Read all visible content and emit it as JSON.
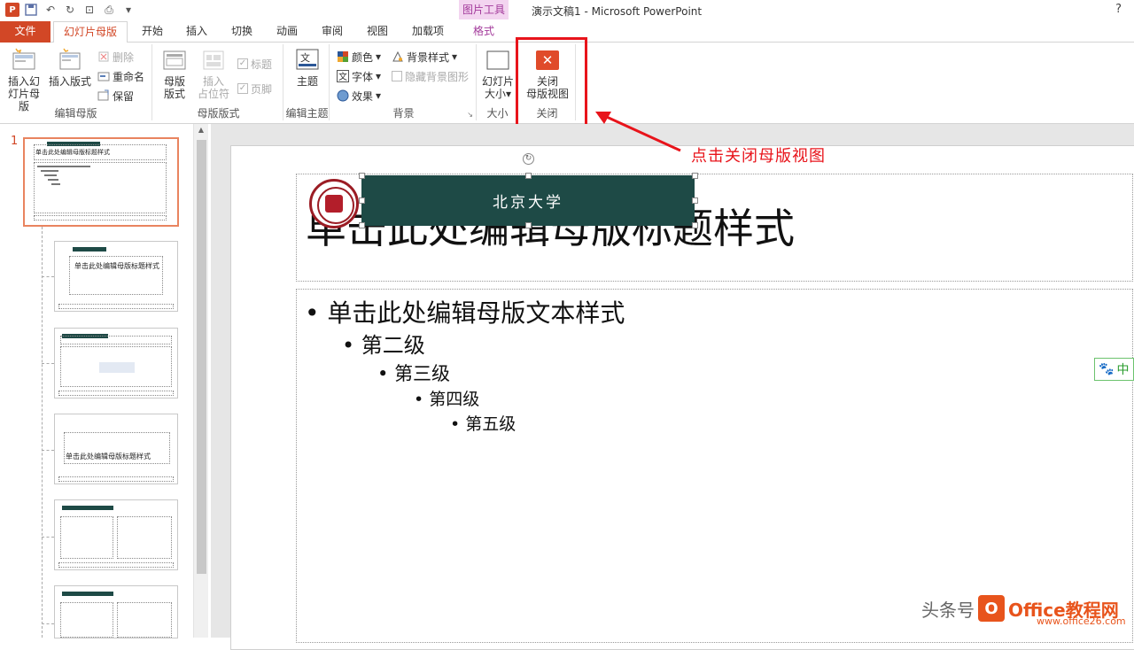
{
  "window": {
    "title": "演示文稿1 - Microsoft PowerPoint",
    "contextual_group": "图片工具",
    "help": "?"
  },
  "tabs": {
    "file": "文件",
    "slide_master": "幻灯片母版",
    "home": "开始",
    "insert": "插入",
    "transitions": "切换",
    "animations": "动画",
    "review": "审阅",
    "view": "视图",
    "addins": "加载项",
    "format": "格式"
  },
  "ribbon": {
    "edit_master": {
      "label": "编辑母版",
      "insert_master": "插入幻灯片母版",
      "insert_master_l1": "插入幻",
      "insert_master_l2": "灯片母版",
      "insert_layout": "插入版式",
      "delete": "删除",
      "rename": "重命名",
      "preserve": "保留"
    },
    "master_layout": {
      "label": "母版版式",
      "master_layout_l1": "母版",
      "master_layout_l2": "版式",
      "insert_placeholder_l1": "插入",
      "insert_placeholder_l2": "占位符",
      "title": "标题",
      "footer": "页脚"
    },
    "edit_theme": {
      "label": "编辑主题",
      "themes": "主题"
    },
    "background": {
      "label": "背景",
      "colors": "颜色",
      "fonts": "字体",
      "effects": "效果",
      "bg_styles": "背景样式",
      "hide_bg": "隐藏背景图形"
    },
    "size": {
      "label": "大小",
      "slide_size_l1": "幻灯片",
      "slide_size_l2": "大小"
    },
    "close": {
      "label": "关闭",
      "close_l1": "关闭",
      "close_l2": "母版视图"
    }
  },
  "thumbnails": {
    "slide_number": "1",
    "master_title": "单击此处编辑母版标题样式",
    "layout_title": "单击此处编辑母版标题样式",
    "banner_small": "北京大学"
  },
  "slide": {
    "banner_text": "北京大学",
    "title": "单击此处编辑母版标题样式",
    "levels": [
      "单击此处编辑母版文本样式",
      "第二级",
      "第三级",
      "第四级",
      "第五级"
    ]
  },
  "annotation": "点击关闭母版视图",
  "ime": "中",
  "watermark": {
    "prefix": "头条号",
    "brand": "Office教程网",
    "site": "www.office26.com"
  },
  "colors": {
    "accent": "#d24726",
    "banner": "#1e4a46",
    "highlight": "#e8141b"
  }
}
